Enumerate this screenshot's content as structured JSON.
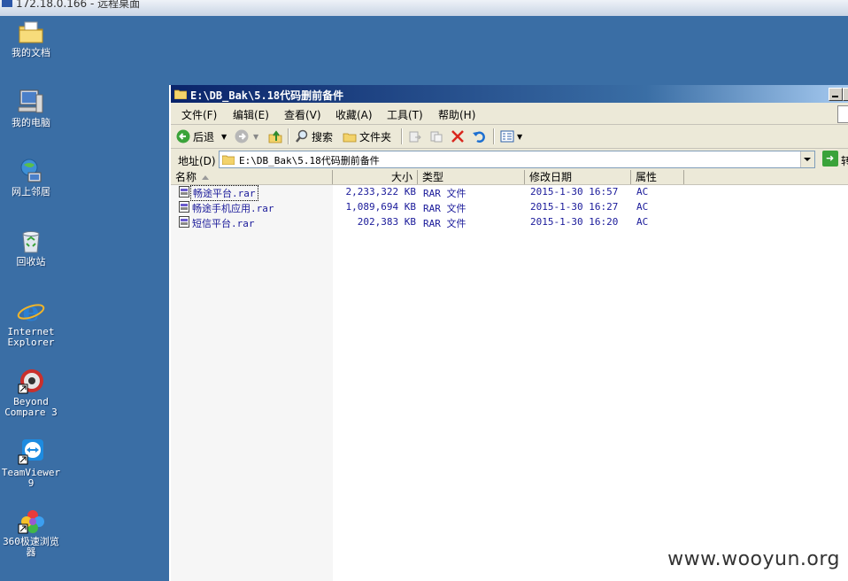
{
  "remote_title": "172.18.0.166 - 远程桌面",
  "desktop_icons": [
    {
      "label": "我的文档",
      "icon": "my-documents-icon"
    },
    {
      "label": "我的电脑",
      "icon": "my-computer-icon"
    },
    {
      "label": "网上邻居",
      "icon": "network-places-icon"
    },
    {
      "label": "回收站",
      "icon": "recycle-bin-icon"
    },
    {
      "label": "Internet Explorer",
      "icon": "internet-explorer-icon"
    },
    {
      "label": "Beyond Compare 3",
      "icon": "beyond-compare-icon"
    },
    {
      "label": "TeamViewer 9",
      "icon": "teamviewer-icon"
    },
    {
      "label": "360极速浏览器",
      "icon": "360-browser-icon"
    }
  ],
  "window": {
    "title": "E:\\DB_Bak\\5.18代码删前备件",
    "menu": [
      "文件(F)",
      "编辑(E)",
      "查看(V)",
      "收藏(A)",
      "工具(T)",
      "帮助(H)"
    ],
    "toolbar": {
      "back": "后退",
      "search": "搜索",
      "folders": "文件夹"
    },
    "address": {
      "label": "地址(D)",
      "value": "E:\\DB_Bak\\5.18代码删前备件",
      "go": "转"
    },
    "columns": [
      "名称",
      "大小",
      "类型",
      "修改日期",
      "属性"
    ],
    "files": [
      {
        "name": "畅途平台.rar",
        "size": "2,233,322 KB",
        "type": "RAR 文件",
        "modified": "2015-1-30 16:57",
        "attr": "AC"
      },
      {
        "name": "畅途手机应用.rar",
        "size": "1,089,694 KB",
        "type": "RAR 文件",
        "modified": "2015-1-30 16:27",
        "attr": "AC"
      },
      {
        "name": "短信平台.rar",
        "size": "202,383 KB",
        "type": "RAR 文件",
        "modified": "2015-1-30 16:20",
        "attr": "AC"
      }
    ]
  },
  "watermark": "www.wooyun.org"
}
